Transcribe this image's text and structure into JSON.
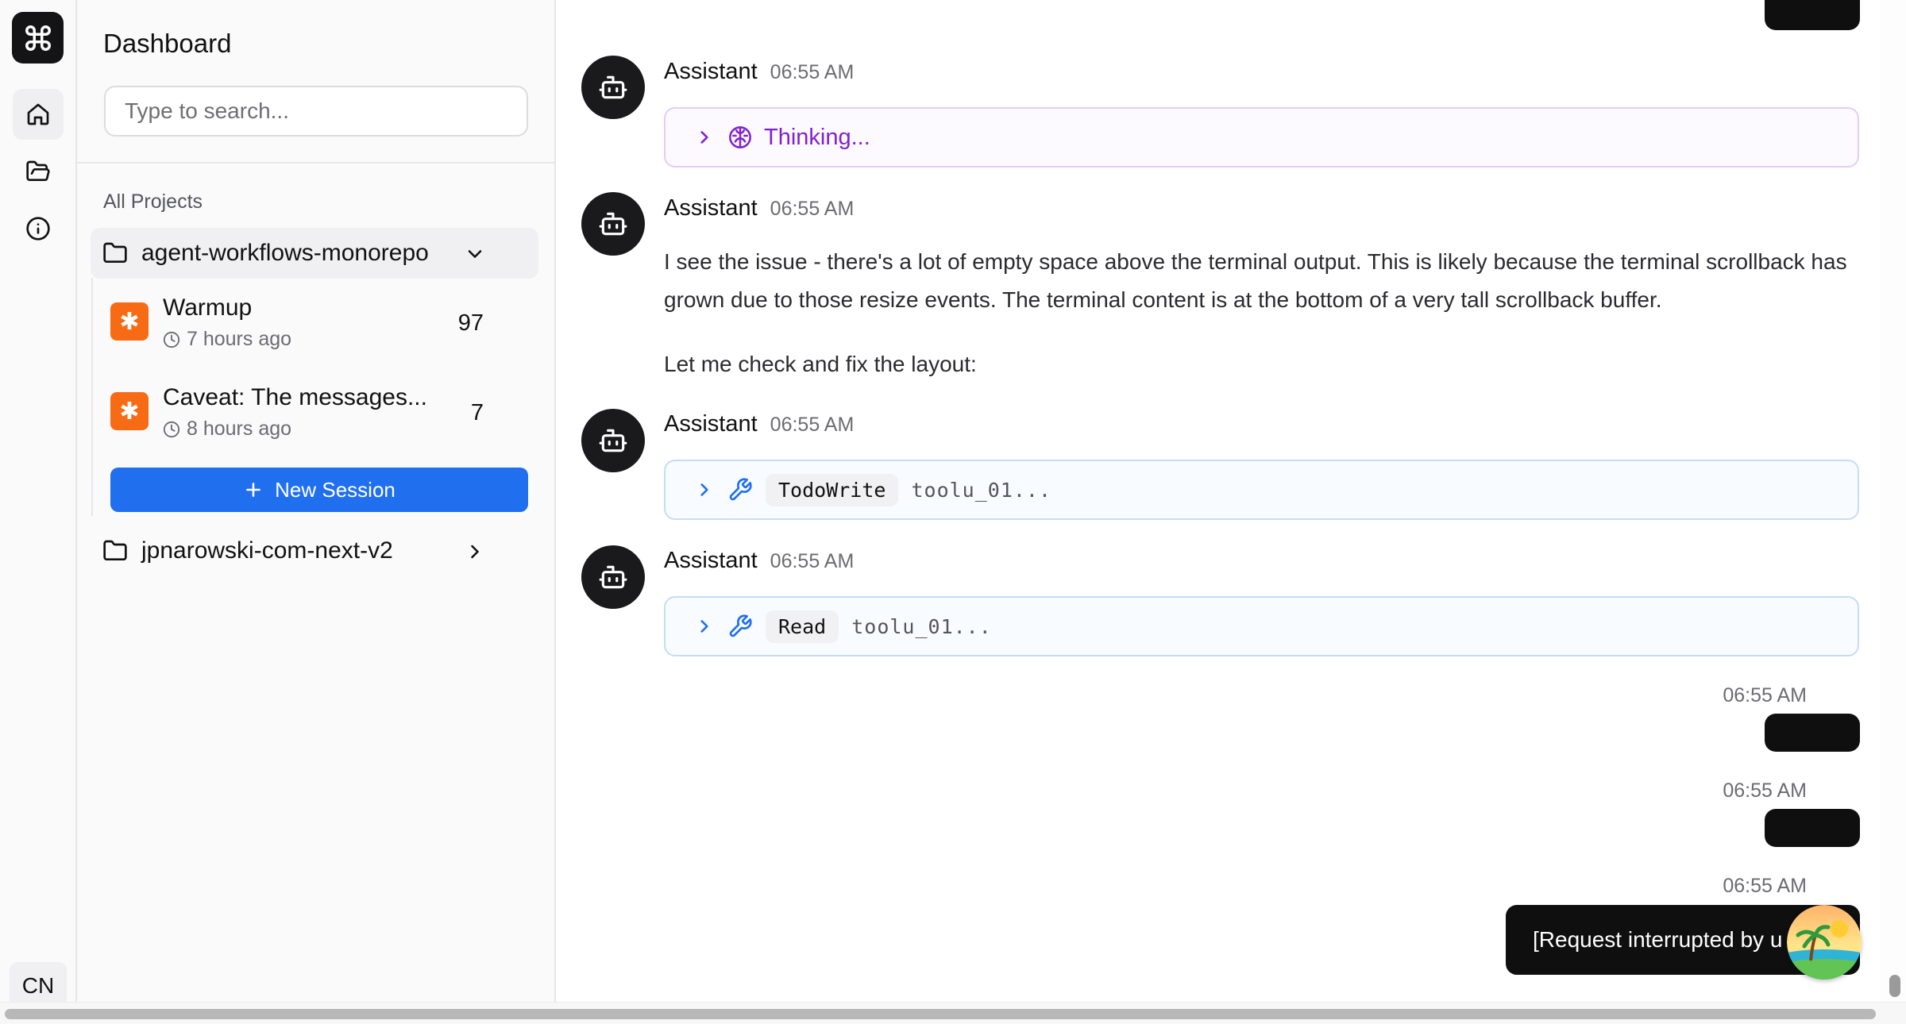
{
  "rail": {
    "logo_icon": "command-icon",
    "items": [
      "home-icon",
      "folder-open-icon",
      "info-icon"
    ],
    "language": "CN"
  },
  "sidebar": {
    "title": "Dashboard",
    "search_placeholder": "Type to search...",
    "section_label": "All Projects",
    "projects": [
      {
        "name": "agent-workflows-monorepo",
        "expanded": true,
        "sessions": [
          {
            "title": "Warmup",
            "time": "7 hours ago",
            "count": "97"
          },
          {
            "title": "Caveat: The messages...",
            "time": "8 hours ago",
            "count": "7"
          }
        ],
        "new_session_label": "New Session"
      },
      {
        "name": "jpnarowski-com-next-v2",
        "expanded": false
      }
    ]
  },
  "chat": {
    "messages": [
      {
        "role": "Assistant",
        "time": "06:55 AM",
        "type": "thinking",
        "label": "Thinking..."
      },
      {
        "role": "Assistant",
        "time": "06:55 AM",
        "type": "text",
        "paragraphs": [
          "I see the issue - there's a lot of empty space above the terminal output. This is likely because the terminal scrollback has grown due to those resize events. The terminal content is at the bottom of a very tall scrollback buffer.",
          "Let me check and fix the layout:"
        ]
      },
      {
        "role": "Assistant",
        "time": "06:55 AM",
        "type": "tool",
        "tool_name": "TodoWrite",
        "tool_id": "toolu_01..."
      },
      {
        "role": "Assistant",
        "time": "06:55 AM",
        "type": "tool",
        "tool_name": "Read",
        "tool_id": "toolu_01..."
      }
    ],
    "user_messages": [
      {
        "time": "06:55 AM"
      },
      {
        "time": "06:55 AM"
      },
      {
        "time": "06:55 AM",
        "text": "[Request interrupted by u"
      }
    ]
  },
  "colors": {
    "primary": "#1f6fef",
    "session_icon": "#f76b15",
    "thinking_accent": "#7e22ce",
    "dark_bubble": "#0f0f10"
  }
}
